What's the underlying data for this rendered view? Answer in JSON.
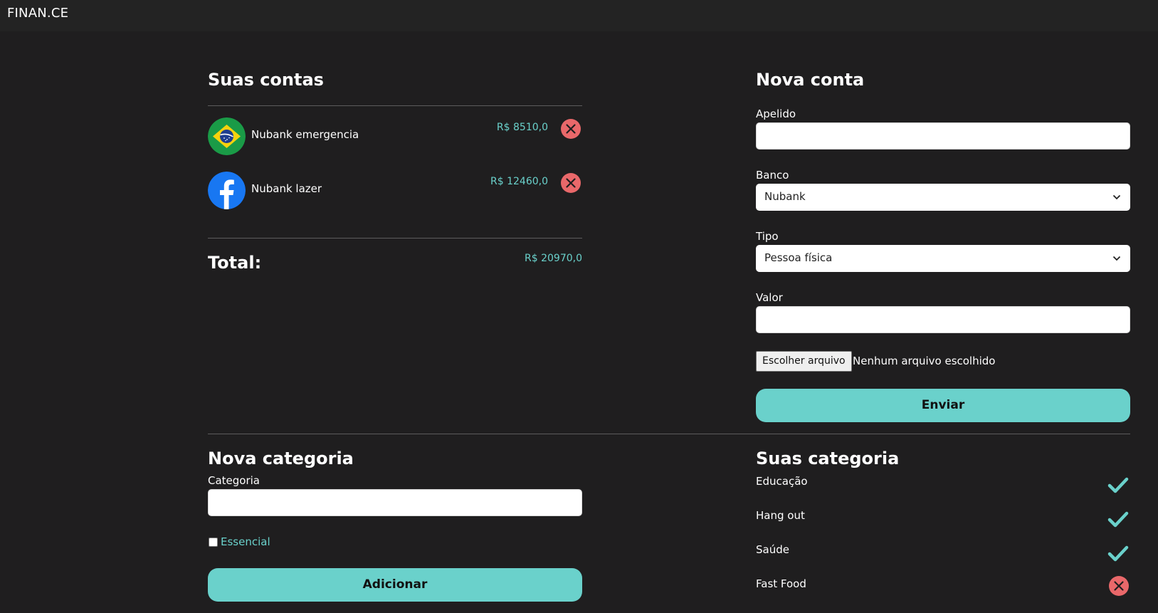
{
  "app": {
    "brand": "FINAN.CE"
  },
  "accounts": {
    "title": "Suas contas",
    "items": [
      {
        "name": "Nubank emergencia",
        "value": "R$ 8510,0",
        "icon": "brazil-flag-icon"
      },
      {
        "name": "Nubank lazer",
        "value": "R$ 12460,0",
        "icon": "facebook-icon"
      }
    ],
    "total_label": "Total:",
    "total_value": "R$ 20970,0"
  },
  "new_account": {
    "title": "Nova conta",
    "nickname_label": "Apelido",
    "nickname_value": "",
    "bank_label": "Banco",
    "bank_selected": "Nubank",
    "type_label": "Tipo",
    "type_selected": "Pessoa física",
    "value_label": "Valor",
    "value_value": "",
    "file_button": "Escolher arquivo",
    "file_status": "Nenhum arquivo escolhido",
    "submit_label": "Enviar"
  },
  "new_category": {
    "title": "Nova categoria",
    "category_label": "Categoria",
    "category_value": "",
    "essential_label": "Essencial",
    "essential_checked": false,
    "submit_label": "Adicionar"
  },
  "categories": {
    "title": "Suas categoria",
    "items": [
      {
        "name": "Educação",
        "essential": true
      },
      {
        "name": "Hang out",
        "essential": true
      },
      {
        "name": "Saúde",
        "essential": true
      },
      {
        "name": "Fast Food",
        "essential": false
      }
    ]
  },
  "colors": {
    "accent": "#6ad1cb",
    "danger": "#e9686a",
    "background": "#1f1e1f",
    "topbar": "#232323"
  }
}
